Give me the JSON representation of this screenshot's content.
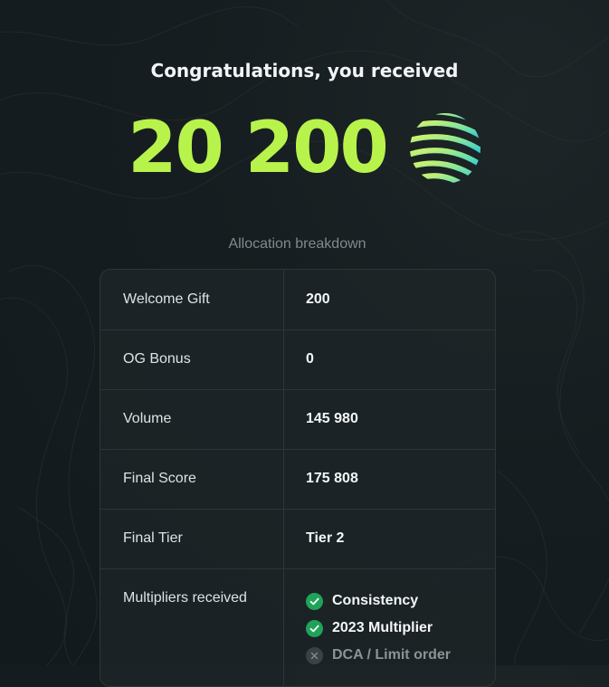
{
  "header": {
    "title": "Congratulations, you received",
    "amount": "20 200",
    "token_icon": "striped-sphere-icon"
  },
  "breakdown": {
    "heading": "Allocation breakdown",
    "rows": [
      {
        "label": "Welcome Gift",
        "value": "200"
      },
      {
        "label": "OG Bonus",
        "value": "0"
      },
      {
        "label": "Volume",
        "value": "145 980"
      },
      {
        "label": "Final Score",
        "value": "175 808"
      },
      {
        "label": "Final Tier",
        "value": "Tier 2"
      }
    ],
    "multipliers": {
      "label": "Multipliers received",
      "items": [
        {
          "name": "Consistency",
          "received": true
        },
        {
          "name": "2023 Multiplier",
          "received": true
        },
        {
          "name": "DCA / Limit order",
          "received": false
        }
      ]
    }
  },
  "colors": {
    "accent_green": "#b8f34c",
    "check_green": "#1fa35a",
    "background": "#161d20"
  }
}
